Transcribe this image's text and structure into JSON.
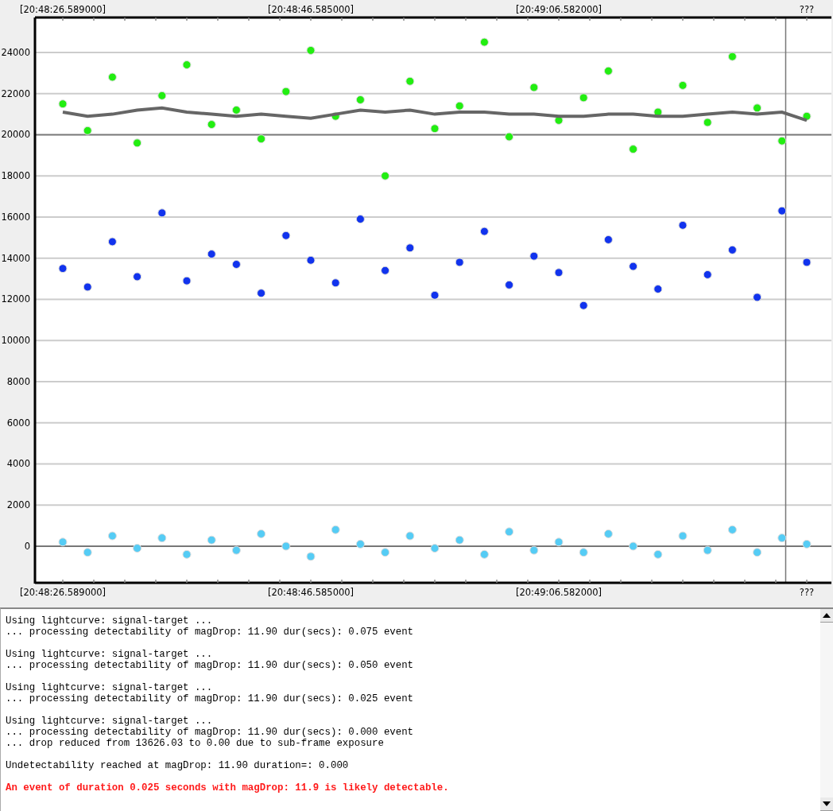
{
  "chart": {
    "top_axis_labels": [
      "[20:48:26.589000]",
      "[20:48:46.585000]",
      "[20:49:06.582000]",
      "???"
    ],
    "chart_data": {
      "type": "scatter",
      "categories": [
        "[20:48:26.589000]",
        null,
        null,
        null,
        null,
        null,
        null,
        null,
        null,
        null,
        "[20:48:46.585000]",
        null,
        null,
        null,
        null,
        null,
        null,
        null,
        null,
        null,
        "[20:49:06.582000]",
        null,
        null,
        null,
        null,
        null,
        null,
        null,
        null,
        null,
        "???"
      ],
      "ylim": [
        -1780,
        25700
      ],
      "yticks": [
        0,
        2000,
        4000,
        6000,
        8000,
        10000,
        12000,
        14000,
        16000,
        18000,
        20000,
        22000,
        24000
      ],
      "series": [
        {
          "color": "#22ee11",
          "values": [
            21500,
            20200,
            22800,
            19600,
            21900,
            23400,
            20500,
            21200,
            19800,
            22100,
            24100,
            20900,
            21700,
            18000,
            22600,
            20300,
            21400,
            24500,
            19900,
            22300,
            20700,
            21800,
            23100,
            19300,
            21100,
            22400,
            20600,
            23800,
            21300,
            19700,
            20900
          ]
        },
        {
          "type": "line",
          "color": "#666666",
          "values": [
            21100,
            20900,
            21000,
            21200,
            21300,
            21100,
            21000,
            20900,
            21000,
            20900,
            20800,
            21000,
            21200,
            21100,
            21200,
            21000,
            21100,
            21100,
            21000,
            21000,
            20900,
            20900,
            21000,
            21000,
            20900,
            20900,
            21000,
            21100,
            21000,
            21100,
            20700
          ]
        },
        {
          "color": "#1133ee",
          "values": [
            13500,
            12600,
            14800,
            13100,
            16200,
            12900,
            14200,
            13700,
            12300,
            15100,
            13900,
            12800,
            15900,
            13400,
            14500,
            12200,
            13800,
            15300,
            12700,
            14100,
            13300,
            11700,
            14900,
            13600,
            12500,
            15600,
            13200,
            14400,
            12100,
            16300,
            13800
          ]
        },
        {
          "color": "#55ccf5",
          "values": [
            200,
            -300,
            500,
            -100,
            400,
            -400,
            300,
            -200,
            600,
            0,
            -500,
            800,
            100,
            -300,
            500,
            -100,
            300,
            -400,
            700,
            -200,
            200,
            -300,
            600,
            0,
            -400,
            500,
            -200,
            800,
            -300,
            400,
            100
          ]
        }
      ],
      "grid": true
    }
  },
  "log": {
    "blocks": [
      {
        "kind": "normal",
        "lines": [
          "Using lightcurve: signal-target ...",
          "... processing detectability of magDrop: 11.90 dur(secs): 0.075 event"
        ]
      },
      {
        "kind": "normal",
        "lines": [
          "Using lightcurve: signal-target ...",
          "... processing detectability of magDrop: 11.90 dur(secs): 0.050 event"
        ]
      },
      {
        "kind": "normal",
        "lines": [
          "Using lightcurve: signal-target ...",
          "... processing detectability of magDrop: 11.90 dur(secs): 0.025 event"
        ]
      },
      {
        "kind": "normal",
        "lines": [
          "Using lightcurve: signal-target ...",
          "... processing detectability of magDrop: 11.90 dur(secs): 0.000 event",
          "... drop reduced from 13626.03 to 0.00 due to sub-frame exposure"
        ]
      },
      {
        "kind": "normal",
        "lines": [
          "Undetectability reached at magDrop: 11.90 duration=: 0.000"
        ]
      },
      {
        "kind": "alert",
        "lines": [
          "An event of duration 0.025 seconds with magDrop: 11.9 is likely detectable."
        ]
      }
    ]
  }
}
